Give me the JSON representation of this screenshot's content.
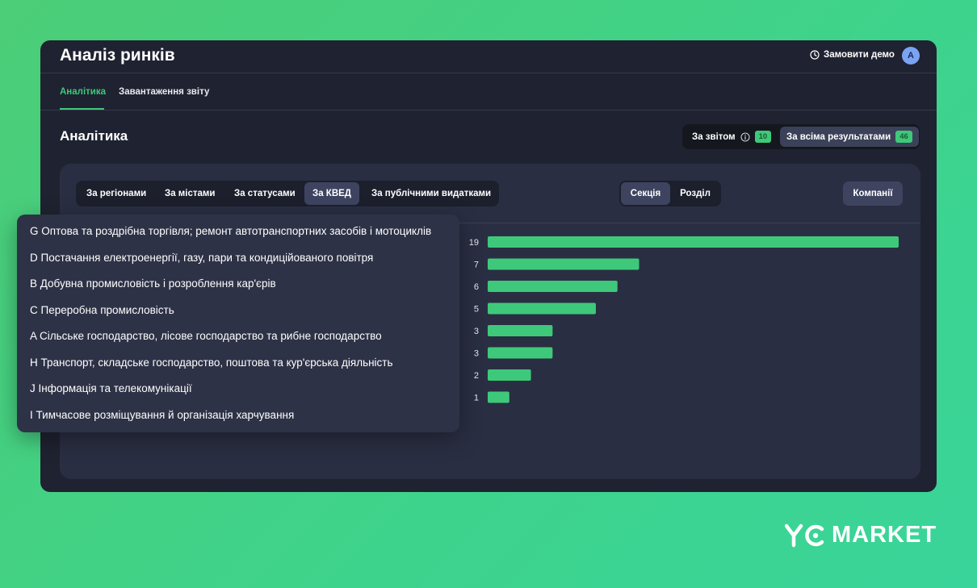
{
  "app": {
    "title": "Аналіз ринків"
  },
  "header": {
    "demo_label": "Замовити демо",
    "avatar_initial": "A"
  },
  "tabs": [
    {
      "label": "Аналітика",
      "active": true
    },
    {
      "label": "Завантаження звіту",
      "active": false
    }
  ],
  "section": {
    "title": "Аналітика"
  },
  "scope_toggle": {
    "by_report": {
      "label": "За звітом",
      "count": "10"
    },
    "all_results": {
      "label": "За всіма результатами",
      "count": "46",
      "active": true
    }
  },
  "filters": [
    {
      "label": "За регіонами"
    },
    {
      "label": "За містами"
    },
    {
      "label": "За статусами"
    },
    {
      "label": "За КВЕД",
      "active": true
    },
    {
      "label": "За публічними видатками"
    }
  ],
  "level_toggle": [
    {
      "label": "Секція",
      "active": true
    },
    {
      "label": "Розділ"
    }
  ],
  "companies_button": "Компанії",
  "dropdown_items": [
    "G Оптова та роздрібна торгівля; ремонт автотранспортних засобів і мотоциклів",
    "D Постачання електроенергії, газу, пари та кондиційованого повітря",
    "B Добувна промисловість і розроблення кар'єрів",
    "C Переробна промисловість",
    "A Сільське господарство, лісове господарство та рибне господарство",
    "H Транспорт, складське господарство, поштова та кур'єрська діяльність",
    "J Інформація та телекомунікації",
    "I Тимчасове розміщування й організація харчування"
  ],
  "chart_data": {
    "type": "bar",
    "orientation": "horizontal",
    "categories": [
      "G",
      "D",
      "B",
      "C",
      "A",
      "H",
      "J",
      "I"
    ],
    "values": [
      19,
      7,
      6,
      5,
      3,
      3,
      2,
      1
    ],
    "xlim": [
      0,
      19
    ],
    "grid": false,
    "bar_color": "#3ec97a"
  },
  "brand": {
    "name": "MARKET",
    "mark": "YC"
  },
  "colors": {
    "accent": "#3ec97a",
    "window_bg": "#1f2230",
    "panel_bg": "#2a2e42",
    "active_control": "#3e4460"
  },
  "icons": {
    "demo": "clock-icon",
    "by_report_info": "info-icon"
  }
}
